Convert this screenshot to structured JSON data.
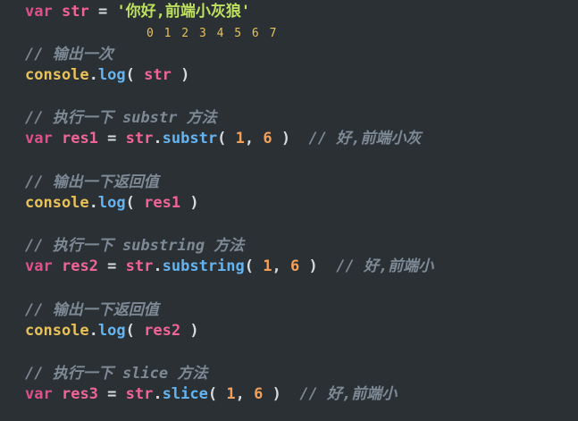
{
  "code": {
    "l1": {
      "kw": "var",
      "name": "str",
      "eq": "=",
      "value": "'你好,前端小灰狼'"
    },
    "index_hint": "0 1 2 3 4 5 6 7",
    "c1": "// 输出一次",
    "l2": {
      "obj": "console",
      "dot": ".",
      "fn": "log",
      "open": "(",
      "arg": "str",
      "close": ")"
    },
    "c2": "// 执行一下 substr 方法",
    "l3": {
      "kw": "var",
      "name": "res1",
      "eq": "=",
      "obj": "str",
      "dot": ".",
      "fn": "substr",
      "open": "(",
      "a1": "1",
      "comma": ",",
      "a2": "6",
      "close": ")",
      "comment": "// 好,前端小灰"
    },
    "c3": "// 输出一下返回值",
    "l4": {
      "obj": "console",
      "dot": ".",
      "fn": "log",
      "open": "(",
      "arg": "res1",
      "close": ")"
    },
    "c4": "// 执行一下 substring 方法",
    "l5": {
      "kw": "var",
      "name": "res2",
      "eq": "=",
      "obj": "str",
      "dot": ".",
      "fn": "substring",
      "open": "(",
      "a1": "1",
      "comma": ",",
      "a2": "6",
      "close": ")",
      "comment": "// 好,前端小"
    },
    "c5": "// 输出一下返回值",
    "l6": {
      "obj": "console",
      "dot": ".",
      "fn": "log",
      "open": "(",
      "arg": "res2",
      "close": ")"
    },
    "c6": "// 执行一下 slice 方法",
    "l7": {
      "kw": "var",
      "name": "res3",
      "eq": "=",
      "obj": "str",
      "dot": ".",
      "fn": "slice",
      "open": "(",
      "a1": "1",
      "comma": ",",
      "a2": "6",
      "close": ")",
      "comment": "// 好,前端小"
    }
  }
}
